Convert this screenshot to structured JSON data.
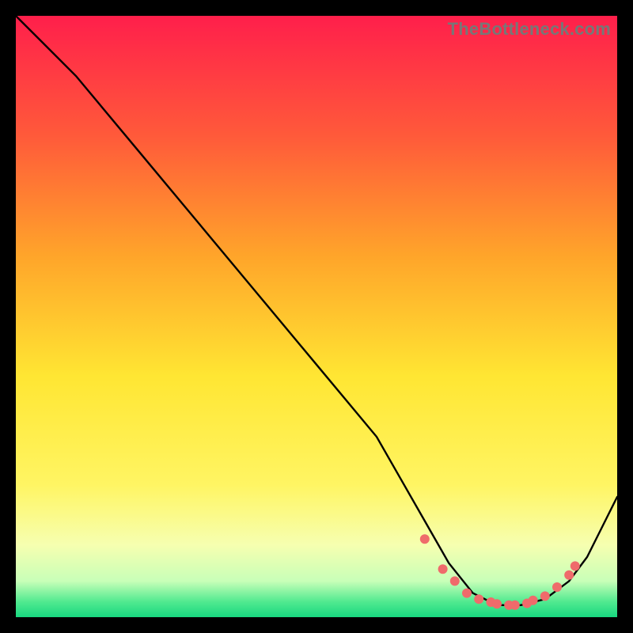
{
  "watermark": "TheBottleneck.com",
  "chart_data": {
    "type": "line",
    "title": "",
    "xlabel": "",
    "ylabel": "",
    "xlim": [
      0,
      100
    ],
    "ylim": [
      0,
      100
    ],
    "grid": false,
    "legend": false,
    "background_gradient": {
      "stops": [
        {
          "offset": 0.0,
          "color": "#ff1f4b"
        },
        {
          "offset": 0.2,
          "color": "#ff5a3a"
        },
        {
          "offset": 0.4,
          "color": "#ffa52a"
        },
        {
          "offset": 0.6,
          "color": "#ffe633"
        },
        {
          "offset": 0.78,
          "color": "#fff563"
        },
        {
          "offset": 0.88,
          "color": "#f6ffb0"
        },
        {
          "offset": 0.94,
          "color": "#c8ffb8"
        },
        {
          "offset": 0.975,
          "color": "#4fe98f"
        },
        {
          "offset": 1.0,
          "color": "#18d880"
        }
      ]
    },
    "curve": {
      "x": [
        0,
        4,
        10,
        20,
        30,
        40,
        50,
        60,
        68,
        72,
        76,
        80,
        84,
        88,
        92,
        95,
        100
      ],
      "y": [
        100,
        96,
        90,
        78,
        66,
        54,
        42,
        30,
        16,
        9,
        4,
        2,
        2,
        3,
        6,
        10,
        20
      ]
    },
    "markers": {
      "x": [
        68,
        71,
        73,
        75,
        77,
        79,
        80,
        82,
        83,
        85,
        86,
        88,
        90,
        92,
        93
      ],
      "y": [
        13,
        8,
        6,
        4,
        3,
        2.5,
        2.2,
        2,
        2,
        2.3,
        2.8,
        3.5,
        5,
        7,
        8.5
      ],
      "color": "#ef6b6b",
      "radius": 6
    }
  }
}
